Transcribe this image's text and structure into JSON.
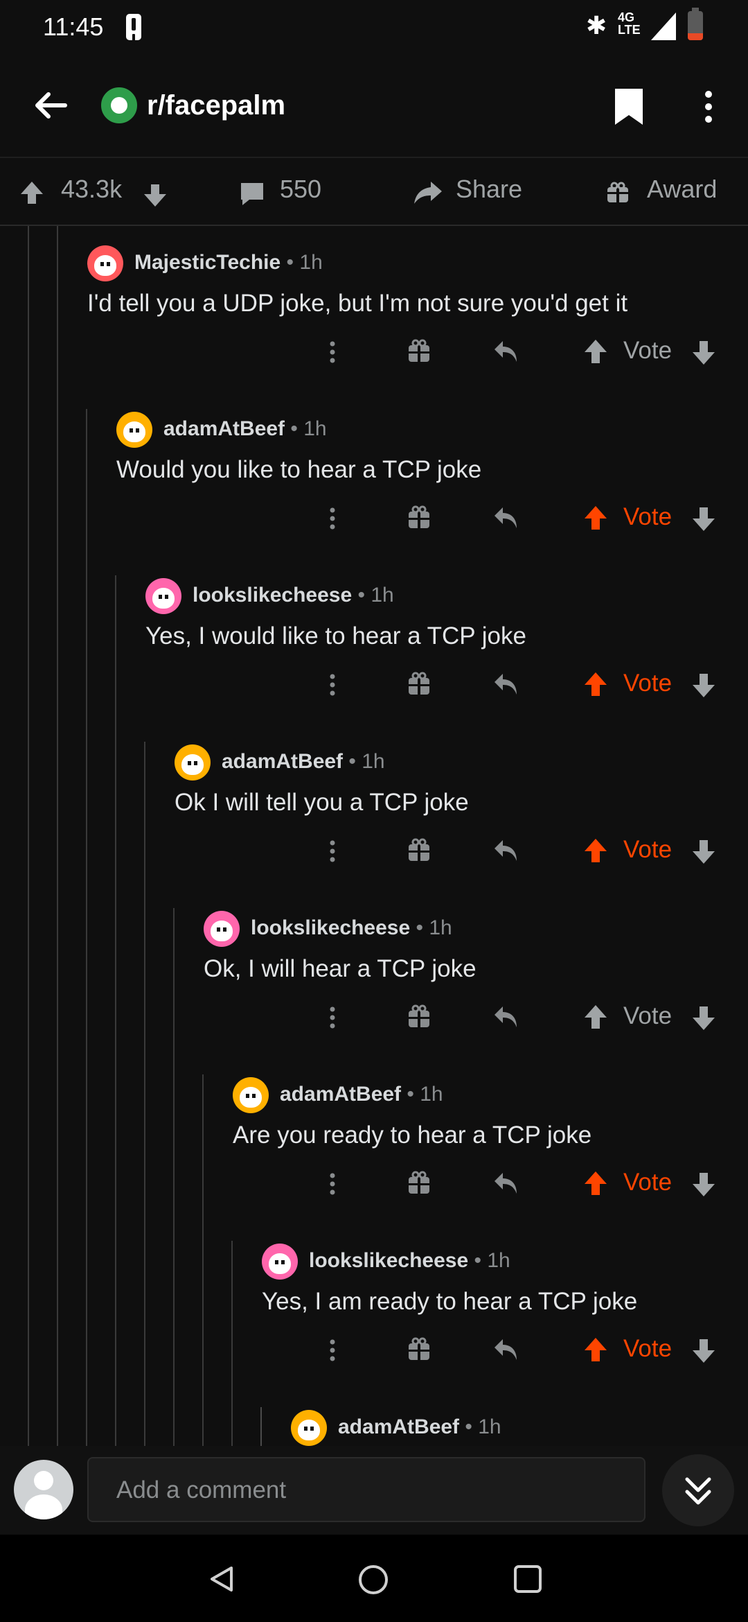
{
  "status_bar": {
    "time": "11:45",
    "network": "4G\nLTE"
  },
  "header": {
    "subreddit": "r/facepalm"
  },
  "post_bar": {
    "score": "43.3k",
    "comments": "550",
    "share": "Share",
    "award": "Award"
  },
  "comments": [
    {
      "user": "MajesticTechie",
      "age": "1h",
      "text": "I'd tell you a UDP joke, but I'm not sure you'd get it",
      "vote_label": "Vote",
      "upvoted": false,
      "avatar_color": "#ff585b"
    },
    {
      "user": "adamAtBeef",
      "age": "1h",
      "text": "Would you like to hear a TCP joke",
      "vote_label": "Vote",
      "upvoted": true,
      "avatar_color": "#ffb000"
    },
    {
      "user": "lookslikecheese",
      "age": "1h",
      "text": "Yes, I would like to hear a TCP joke",
      "vote_label": "Vote",
      "upvoted": true,
      "avatar_color": "#ff66ac"
    },
    {
      "user": "adamAtBeef",
      "age": "1h",
      "text": "Ok I will tell you a TCP joke",
      "vote_label": "Vote",
      "upvoted": true,
      "avatar_color": "#ffb000"
    },
    {
      "user": "lookslikecheese",
      "age": "1h",
      "text": "Ok, I will hear a TCP joke",
      "vote_label": "Vote",
      "upvoted": false,
      "avatar_color": "#ff66ac"
    },
    {
      "user": "adamAtBeef",
      "age": "1h",
      "text": "Are you ready to hear a TCP joke",
      "vote_label": "Vote",
      "upvoted": true,
      "avatar_color": "#ffb000"
    },
    {
      "user": "lookslikecheese",
      "age": "1h",
      "text": "Yes, I am ready to hear a TCP joke",
      "vote_label": "Vote",
      "upvoted": true,
      "avatar_color": "#ff66ac"
    },
    {
      "user": "adamAtBeef",
      "age": "1h",
      "text": "",
      "vote_label": "",
      "upvoted": false,
      "avatar_color": "#ffb000"
    }
  ],
  "composer": {
    "placeholder": "Add a comment"
  },
  "colors": {
    "accent": "#ff4500",
    "background": "#0f0f0f",
    "muted": "#a0a4a6"
  }
}
